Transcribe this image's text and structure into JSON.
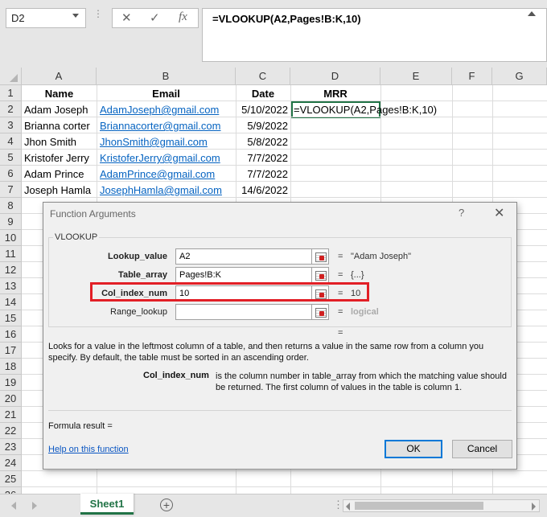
{
  "formula_bar": {
    "name_box": "D2",
    "cancel_icon": "✕",
    "enter_icon": "✓",
    "function_icon": "fx",
    "formula": "=VLOOKUP(A2,Pages!B:K,10)"
  },
  "columns": [
    "A",
    "B",
    "C",
    "D",
    "E",
    "F",
    "G"
  ],
  "rows": [
    "1",
    "2",
    "3",
    "4",
    "5",
    "6",
    "7",
    "8",
    "9",
    "10",
    "11",
    "12",
    "13",
    "14",
    "15",
    "16",
    "17",
    "18",
    "19",
    "20",
    "21",
    "22",
    "23",
    "24",
    "25",
    "26"
  ],
  "table": {
    "headers": [
      "Name",
      "Email",
      "Date",
      "MRR"
    ],
    "rows": [
      [
        "Adam Joseph",
        "AdamJoseph@gmail.com",
        "5/10/2022",
        "=VLOOKUP(A2,Pages!B:K,10)"
      ],
      [
        "Brianna corter",
        "Briannacorter@gmail.com",
        "5/9/2022",
        ""
      ],
      [
        "Jhon Smith",
        "JhonSmith@gmail.com",
        "5/8/2022",
        ""
      ],
      [
        "Kristofer Jerry",
        "KristoferJerry@gmail.com",
        "7/7/2022",
        ""
      ],
      [
        "Adam Prince",
        "AdamPrince@gmail.com",
        "7/7/2022",
        ""
      ],
      [
        "Joseph Hamla",
        "JosephHamla@gmail.com",
        "14/6/2022",
        ""
      ]
    ]
  },
  "dialog": {
    "title": "Function Arguments",
    "help_icon": "?",
    "close_icon": "✕",
    "function_name": "VLOOKUP",
    "args": [
      {
        "label": "Lookup_value",
        "value": "A2",
        "result": "\"Adam Joseph\""
      },
      {
        "label": "Table_array",
        "value": "Pages!B:K",
        "result": "{...}"
      },
      {
        "label": "Col_index_num",
        "value": "10",
        "result": "10"
      },
      {
        "label": "Range_lookup",
        "value": "",
        "result": "logical"
      }
    ],
    "equals": "=",
    "description": "Looks for a value in the leftmost column of a table, and then returns a value in the same row from a column you specify. By default, the table must be sorted in an ascending order.",
    "arg_desc_label": "Col_index_num",
    "arg_desc_text": "is the column number in table_array from which the matching value should be returned. The first column of values in the table is column 1.",
    "formula_result": "Formula result =",
    "help_link": "Help on this function",
    "ok": "OK",
    "cancel": "Cancel"
  },
  "sheetbar": {
    "tab": "Sheet1",
    "add_icon": "+"
  },
  "colors": {
    "accent_green": "#217346",
    "link_blue": "#0563c1",
    "highlight_red": "#e21f26"
  }
}
